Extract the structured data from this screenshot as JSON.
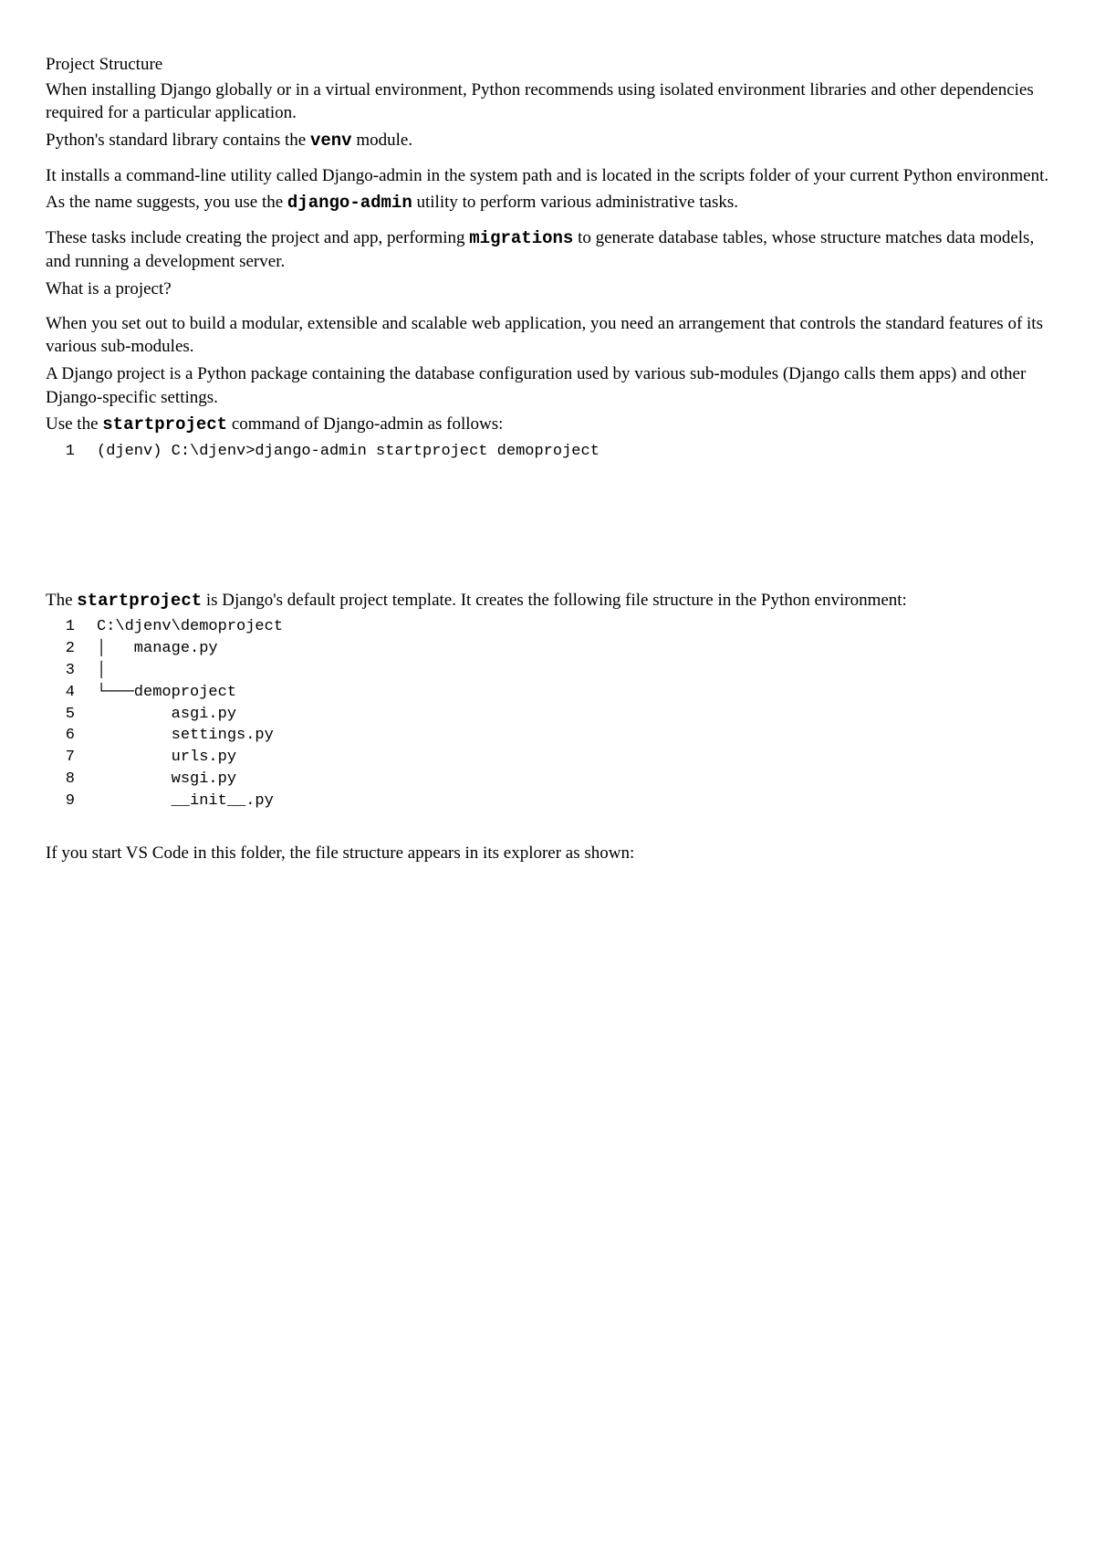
{
  "title": "Project Structure",
  "p1a": "When installing Django globally or in a virtual environment, Python recommends using isolated environment libraries and other dependencies required for a particular application.",
  "p1b_pre": "Python's standard library contains the ",
  "p1b_code": "venv",
  "p1b_post": " module.",
  "p2a": "It installs a command-line utility called Django-admin in the system path and is located in the scripts folder of your current Python environment.",
  "p2b_pre": "As the name suggests, you use the ",
  "p2b_code": "django-admin",
  "p2b_post": " utility to perform various administrative tasks.",
  "p3a_pre": "These tasks include creating the project and app, performing ",
  "p3a_code": "migrations",
  "p3a_post": " to generate database tables, whose structure matches data models, and running a development server.",
  "p3b": "What is a project?",
  "p4a": "When you set out to build a modular, extensible and scalable web application, you need an arrangement that controls the standard features of its various sub-modules.",
  "p4b": "A Django project is a Python package containing the database configuration used by various sub-modules (Django calls them apps) and other Django-specific settings.",
  "p4c_pre": "Use the ",
  "p4c_code": "startproject",
  "p4c_post": " command of Django-admin as follows:",
  "code1": {
    "lines": [
      {
        "n": "1",
        "t": "(djenv) C:\\djenv>django-admin startproject demoproject"
      }
    ]
  },
  "p5_pre": "The ",
  "p5_code": "startproject",
  "p5_post": " is Django's default project template. It creates the following file structure in the Python environment:",
  "code2": {
    "lines": [
      {
        "n": "1",
        "t": "C:\\djenv\\demoproject"
      },
      {
        "n": "2",
        "t": "│   manage.py"
      },
      {
        "n": "3",
        "t": "│ "
      },
      {
        "n": "4",
        "t": "└───demoproject"
      },
      {
        "n": "5",
        "t": "        asgi.py"
      },
      {
        "n": "6",
        "t": "        settings.py"
      },
      {
        "n": "7",
        "t": "        urls.py"
      },
      {
        "n": "8",
        "t": "        wsgi.py"
      },
      {
        "n": "9",
        "t": "        __init__.py"
      }
    ]
  },
  "p6": "If you start VS Code in this folder, the file structure appears in its explorer as shown:"
}
